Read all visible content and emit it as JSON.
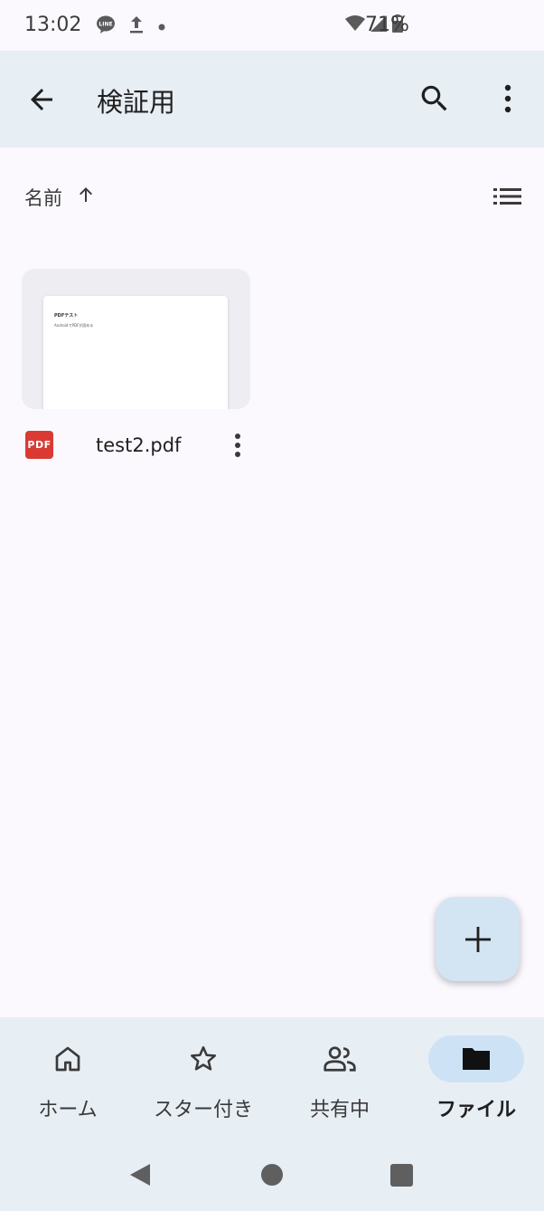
{
  "status_bar": {
    "time": "13:02",
    "left_icons": [
      "line-app-icon",
      "upload-icon",
      "dot-icon"
    ],
    "right_icons": [
      "wifi-icon",
      "signal-icon",
      "battery-icon"
    ],
    "battery": "71%"
  },
  "app_bar": {
    "title": "検証用",
    "back_icon": "arrow-back-icon",
    "search_icon": "search-icon",
    "more_icon": "more-vert-icon"
  },
  "sort": {
    "label": "名前",
    "direction_icon": "arrow-up-icon",
    "view_icon": "list-view-icon"
  },
  "files": [
    {
      "name": "test2.pdf",
      "type_badge": "PDF",
      "thumbnail_heading": "PDFテスト",
      "thumbnail_body": "AndroidでPDFが読める"
    }
  ],
  "fab": {
    "icon": "add-icon"
  },
  "bottom_nav": {
    "items": [
      {
        "label": "ホーム",
        "icon": "home-icon",
        "active": false
      },
      {
        "label": "スター付き",
        "icon": "star-icon",
        "active": false
      },
      {
        "label": "共有中",
        "icon": "people-icon",
        "active": false
      },
      {
        "label": "ファイル",
        "icon": "folder-icon",
        "active": true
      }
    ]
  },
  "colors": {
    "background": "#fbf9fe",
    "app_bar": "#e7eef4",
    "fab": "#d3e4f3",
    "active_nav_pill": "#cde3f5",
    "pdf_badge": "#d93b34"
  }
}
